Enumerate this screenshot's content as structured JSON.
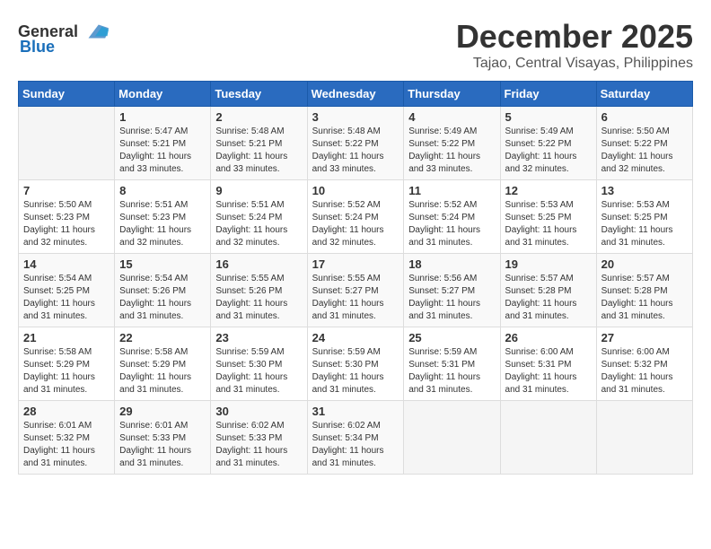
{
  "header": {
    "logo_general": "General",
    "logo_blue": "Blue",
    "month": "December 2025",
    "location": "Tajao, Central Visayas, Philippines"
  },
  "weekdays": [
    "Sunday",
    "Monday",
    "Tuesday",
    "Wednesday",
    "Thursday",
    "Friday",
    "Saturday"
  ],
  "weeks": [
    [
      {
        "day": "",
        "info": ""
      },
      {
        "day": "1",
        "info": "Sunrise: 5:47 AM\nSunset: 5:21 PM\nDaylight: 11 hours\nand 33 minutes."
      },
      {
        "day": "2",
        "info": "Sunrise: 5:48 AM\nSunset: 5:21 PM\nDaylight: 11 hours\nand 33 minutes."
      },
      {
        "day": "3",
        "info": "Sunrise: 5:48 AM\nSunset: 5:22 PM\nDaylight: 11 hours\nand 33 minutes."
      },
      {
        "day": "4",
        "info": "Sunrise: 5:49 AM\nSunset: 5:22 PM\nDaylight: 11 hours\nand 33 minutes."
      },
      {
        "day": "5",
        "info": "Sunrise: 5:49 AM\nSunset: 5:22 PM\nDaylight: 11 hours\nand 32 minutes."
      },
      {
        "day": "6",
        "info": "Sunrise: 5:50 AM\nSunset: 5:22 PM\nDaylight: 11 hours\nand 32 minutes."
      }
    ],
    [
      {
        "day": "7",
        "info": "Sunrise: 5:50 AM\nSunset: 5:23 PM\nDaylight: 11 hours\nand 32 minutes."
      },
      {
        "day": "8",
        "info": "Sunrise: 5:51 AM\nSunset: 5:23 PM\nDaylight: 11 hours\nand 32 minutes."
      },
      {
        "day": "9",
        "info": "Sunrise: 5:51 AM\nSunset: 5:24 PM\nDaylight: 11 hours\nand 32 minutes."
      },
      {
        "day": "10",
        "info": "Sunrise: 5:52 AM\nSunset: 5:24 PM\nDaylight: 11 hours\nand 32 minutes."
      },
      {
        "day": "11",
        "info": "Sunrise: 5:52 AM\nSunset: 5:24 PM\nDaylight: 11 hours\nand 31 minutes."
      },
      {
        "day": "12",
        "info": "Sunrise: 5:53 AM\nSunset: 5:25 PM\nDaylight: 11 hours\nand 31 minutes."
      },
      {
        "day": "13",
        "info": "Sunrise: 5:53 AM\nSunset: 5:25 PM\nDaylight: 11 hours\nand 31 minutes."
      }
    ],
    [
      {
        "day": "14",
        "info": "Sunrise: 5:54 AM\nSunset: 5:25 PM\nDaylight: 11 hours\nand 31 minutes."
      },
      {
        "day": "15",
        "info": "Sunrise: 5:54 AM\nSunset: 5:26 PM\nDaylight: 11 hours\nand 31 minutes."
      },
      {
        "day": "16",
        "info": "Sunrise: 5:55 AM\nSunset: 5:26 PM\nDaylight: 11 hours\nand 31 minutes."
      },
      {
        "day": "17",
        "info": "Sunrise: 5:55 AM\nSunset: 5:27 PM\nDaylight: 11 hours\nand 31 minutes."
      },
      {
        "day": "18",
        "info": "Sunrise: 5:56 AM\nSunset: 5:27 PM\nDaylight: 11 hours\nand 31 minutes."
      },
      {
        "day": "19",
        "info": "Sunrise: 5:57 AM\nSunset: 5:28 PM\nDaylight: 11 hours\nand 31 minutes."
      },
      {
        "day": "20",
        "info": "Sunrise: 5:57 AM\nSunset: 5:28 PM\nDaylight: 11 hours\nand 31 minutes."
      }
    ],
    [
      {
        "day": "21",
        "info": "Sunrise: 5:58 AM\nSunset: 5:29 PM\nDaylight: 11 hours\nand 31 minutes."
      },
      {
        "day": "22",
        "info": "Sunrise: 5:58 AM\nSunset: 5:29 PM\nDaylight: 11 hours\nand 31 minutes."
      },
      {
        "day": "23",
        "info": "Sunrise: 5:59 AM\nSunset: 5:30 PM\nDaylight: 11 hours\nand 31 minutes."
      },
      {
        "day": "24",
        "info": "Sunrise: 5:59 AM\nSunset: 5:30 PM\nDaylight: 11 hours\nand 31 minutes."
      },
      {
        "day": "25",
        "info": "Sunrise: 5:59 AM\nSunset: 5:31 PM\nDaylight: 11 hours\nand 31 minutes."
      },
      {
        "day": "26",
        "info": "Sunrise: 6:00 AM\nSunset: 5:31 PM\nDaylight: 11 hours\nand 31 minutes."
      },
      {
        "day": "27",
        "info": "Sunrise: 6:00 AM\nSunset: 5:32 PM\nDaylight: 11 hours\nand 31 minutes."
      }
    ],
    [
      {
        "day": "28",
        "info": "Sunrise: 6:01 AM\nSunset: 5:32 PM\nDaylight: 11 hours\nand 31 minutes."
      },
      {
        "day": "29",
        "info": "Sunrise: 6:01 AM\nSunset: 5:33 PM\nDaylight: 11 hours\nand 31 minutes."
      },
      {
        "day": "30",
        "info": "Sunrise: 6:02 AM\nSunset: 5:33 PM\nDaylight: 11 hours\nand 31 minutes."
      },
      {
        "day": "31",
        "info": "Sunrise: 6:02 AM\nSunset: 5:34 PM\nDaylight: 11 hours\nand 31 minutes."
      },
      {
        "day": "",
        "info": ""
      },
      {
        "day": "",
        "info": ""
      },
      {
        "day": "",
        "info": ""
      }
    ]
  ]
}
